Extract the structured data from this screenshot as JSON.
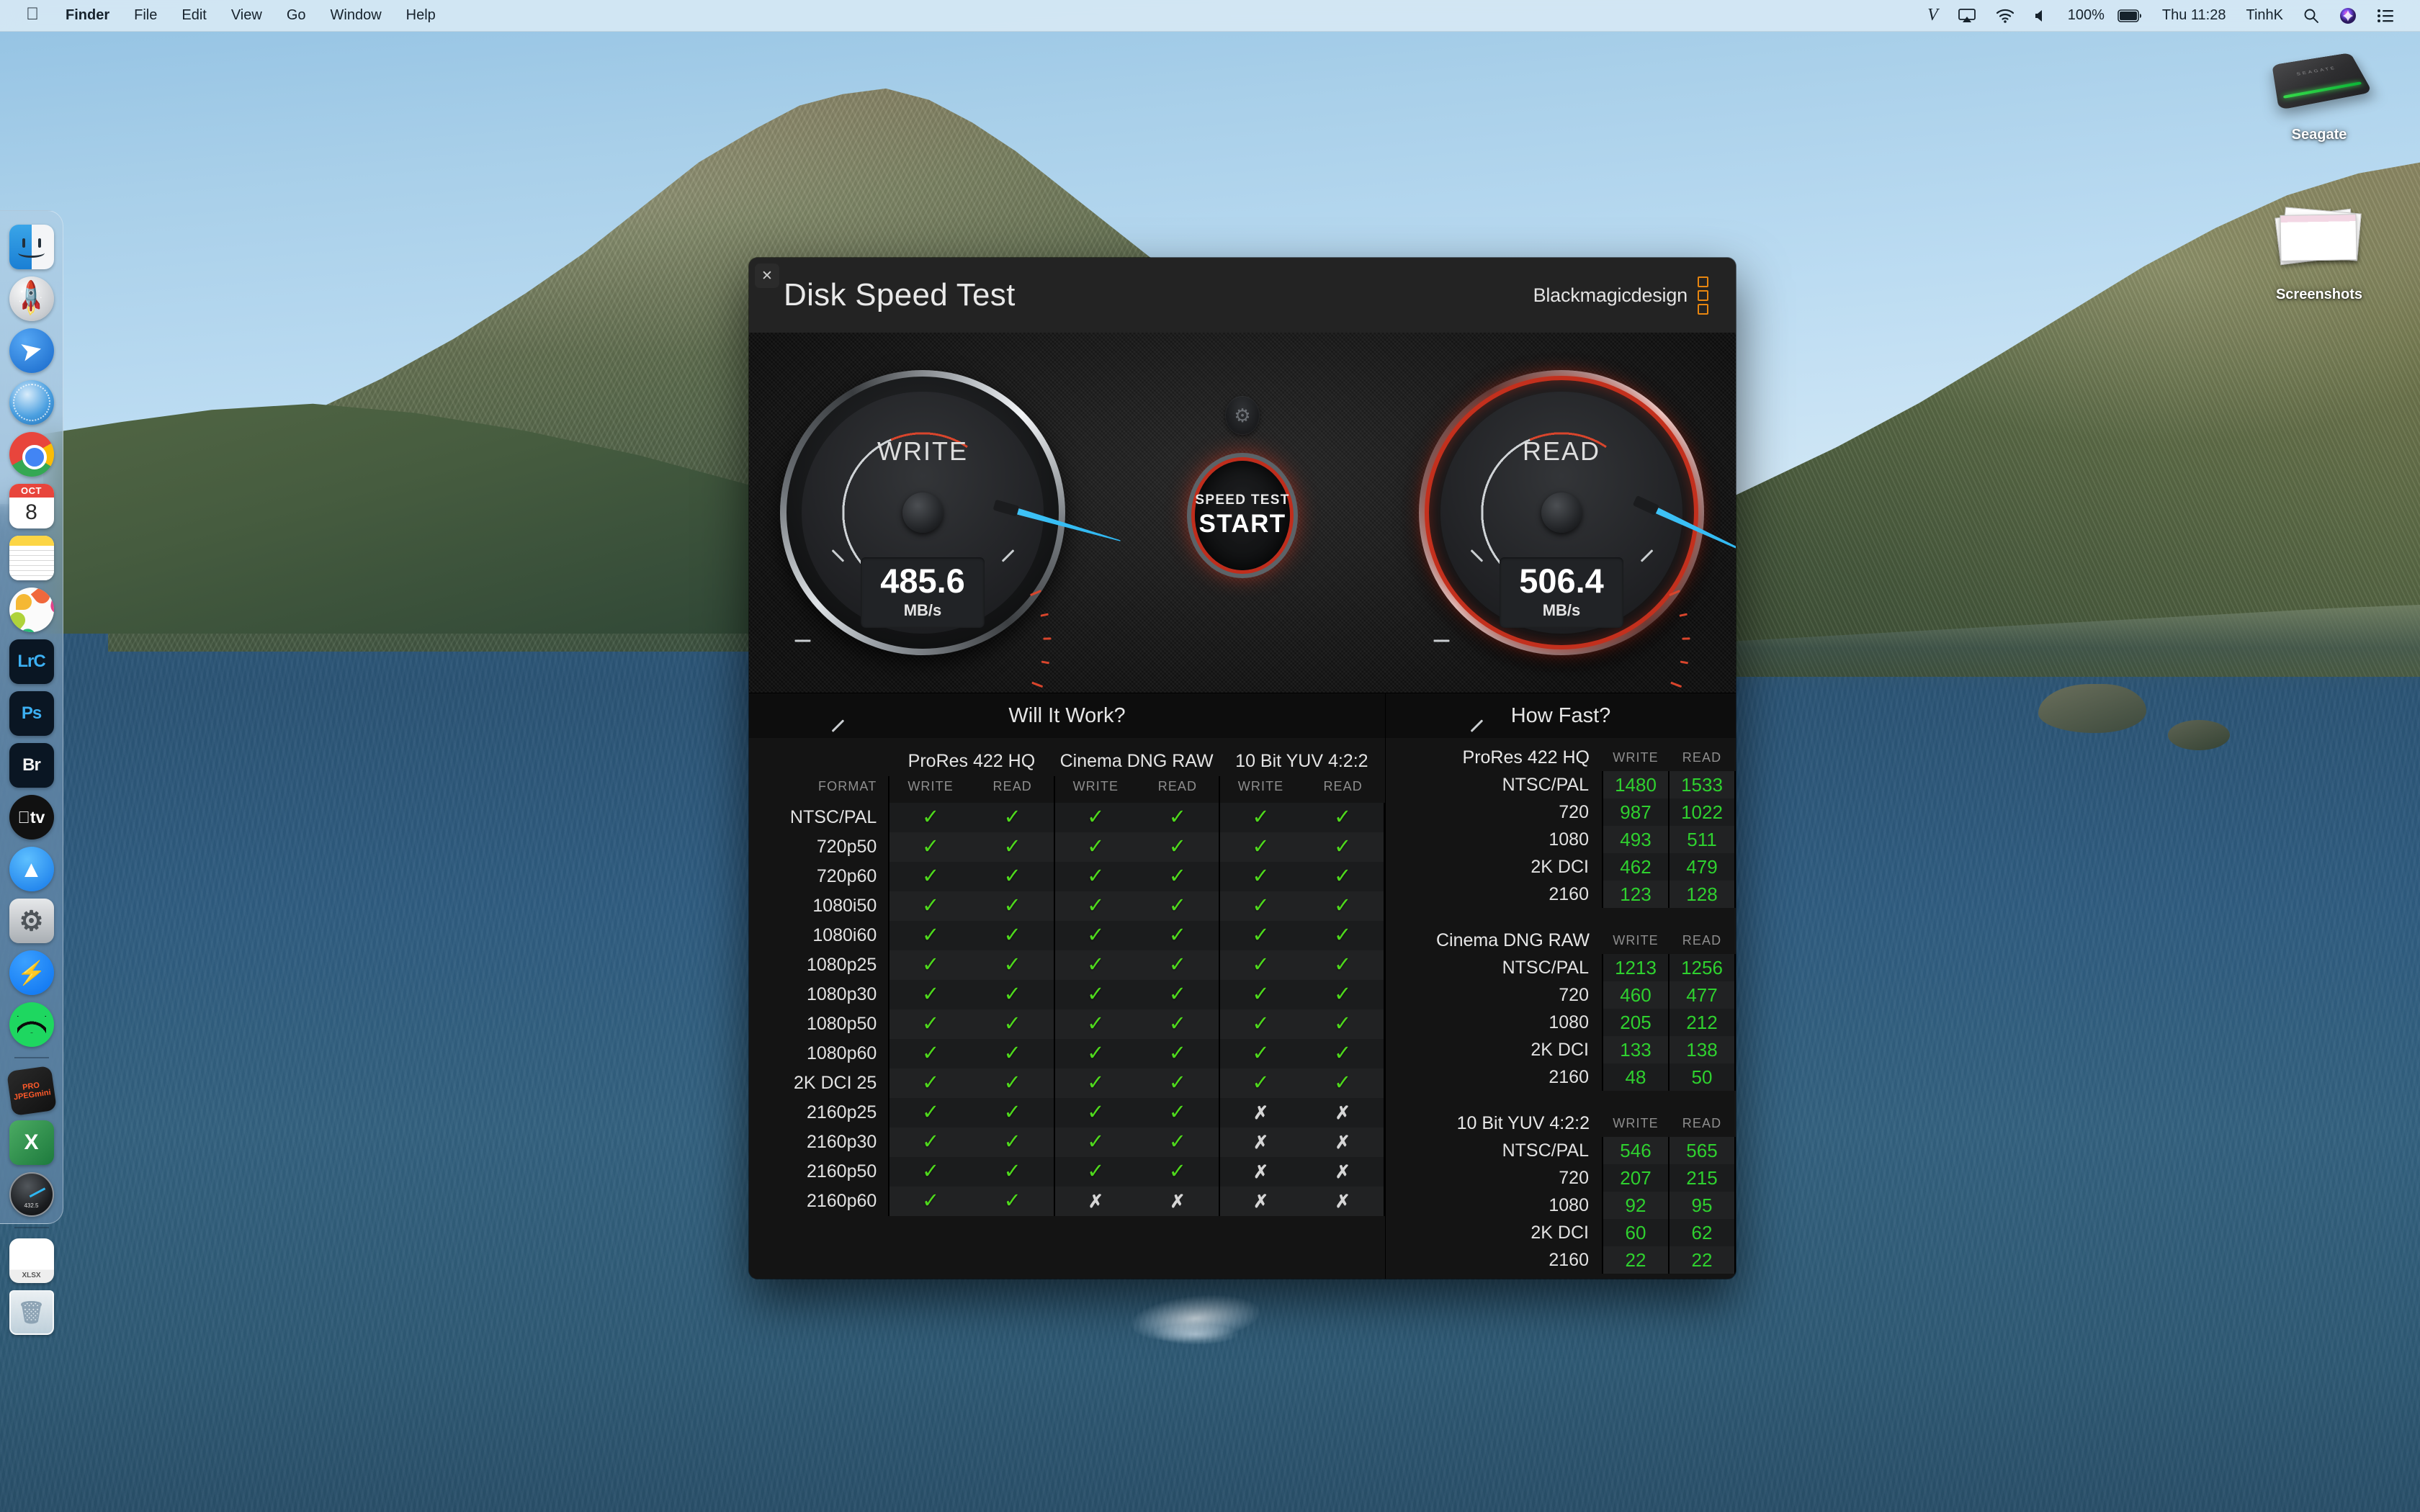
{
  "menubar": {
    "apple_icon": "apple-logo",
    "items": [
      "Finder",
      "File",
      "Edit",
      "View",
      "Go",
      "Window",
      "Help"
    ],
    "status": {
      "vpn": "V",
      "airplay_icon": "airplay-icon",
      "wifi_icon": "wifi-icon",
      "volume_icon": "volume-icon",
      "battery_percent": "100%",
      "battery_icon": "battery-icon",
      "datetime": "Thu 11:28",
      "user": "TinhK",
      "search_icon": "search-icon",
      "siri_icon": "siri-icon",
      "controlcenter_icon": "control-center-icon"
    }
  },
  "dock": {
    "items": [
      {
        "name": "finder",
        "label": "Finder",
        "running": true
      },
      {
        "name": "launchpad",
        "label": "Launchpad",
        "running": false
      },
      {
        "name": "spark",
        "label": "Spark",
        "running": true
      },
      {
        "name": "safari",
        "label": "Safari",
        "running": false
      },
      {
        "name": "chrome",
        "label": "Google Chrome",
        "running": true
      },
      {
        "name": "calendar",
        "label": "Calendar",
        "month": "OCT",
        "day": "8",
        "running": false
      },
      {
        "name": "notes",
        "label": "Notes",
        "running": false
      },
      {
        "name": "photos",
        "label": "Photos",
        "running": false
      },
      {
        "name": "lightroom-classic",
        "label": "LrC",
        "running": false
      },
      {
        "name": "photoshop",
        "label": "Ps",
        "running": false
      },
      {
        "name": "bridge",
        "label": "Br",
        "running": false
      },
      {
        "name": "apple-tv",
        "label": "tv",
        "running": false
      },
      {
        "name": "app-store",
        "label": "App Store",
        "running": true
      },
      {
        "name": "system-preferences",
        "label": "System Preferences",
        "running": false
      },
      {
        "name": "messenger",
        "label": "Messenger",
        "running": true
      },
      {
        "name": "spotify",
        "label": "Spotify",
        "running": false
      },
      {
        "name": "jpegmini-pro",
        "label": "PRO JPEGmini",
        "running": false
      },
      {
        "name": "excel",
        "label": "X",
        "running": true
      },
      {
        "name": "disk-speed-test",
        "label": "Disk Speed Test",
        "value": "432.5",
        "running": true
      },
      {
        "name": "xlsx-file",
        "label": "XLSX",
        "running": false
      },
      {
        "name": "trash",
        "label": "Trash",
        "running": false
      }
    ]
  },
  "desktop_icons": [
    {
      "name": "seagate-drive",
      "label": "Seagate"
    },
    {
      "name": "screenshots-folder",
      "label": "Screenshots"
    }
  ],
  "window": {
    "title": "Disk Speed Test",
    "brand": "Blackmagicdesign",
    "close_label": "✕",
    "brand_color": "#e8860f"
  },
  "gauges": {
    "write": {
      "label": "WRITE",
      "value": "485.6",
      "unit": "MB/s",
      "needle_color": "#2fb6f0"
    },
    "read": {
      "label": "READ",
      "value": "506.4",
      "unit": "MB/s",
      "needle_color": "#2fb6f0"
    },
    "start_button": {
      "line1": "SPEED TEST",
      "line2": "START"
    },
    "settings_icon": "gear-icon"
  },
  "will_it_work": {
    "title": "Will It Work?",
    "format_header": "FORMAT",
    "groups": [
      "ProRes 422 HQ",
      "Cinema DNG RAW",
      "10 Bit YUV 4:2:2"
    ],
    "sub_headers": [
      "WRITE",
      "READ",
      "WRITE",
      "READ",
      "WRITE",
      "READ"
    ],
    "ok_glyph": "✓",
    "fail_glyph": "✗",
    "rows": [
      {
        "format": "NTSC/PAL",
        "cells": [
          true,
          true,
          true,
          true,
          true,
          true
        ]
      },
      {
        "format": "720p50",
        "cells": [
          true,
          true,
          true,
          true,
          true,
          true
        ]
      },
      {
        "format": "720p60",
        "cells": [
          true,
          true,
          true,
          true,
          true,
          true
        ]
      },
      {
        "format": "1080i50",
        "cells": [
          true,
          true,
          true,
          true,
          true,
          true
        ]
      },
      {
        "format": "1080i60",
        "cells": [
          true,
          true,
          true,
          true,
          true,
          true
        ]
      },
      {
        "format": "1080p25",
        "cells": [
          true,
          true,
          true,
          true,
          true,
          true
        ]
      },
      {
        "format": "1080p30",
        "cells": [
          true,
          true,
          true,
          true,
          true,
          true
        ]
      },
      {
        "format": "1080p50",
        "cells": [
          true,
          true,
          true,
          true,
          true,
          true
        ]
      },
      {
        "format": "1080p60",
        "cells": [
          true,
          true,
          true,
          true,
          true,
          true
        ]
      },
      {
        "format": "2K DCI 25",
        "cells": [
          true,
          true,
          true,
          true,
          true,
          true
        ]
      },
      {
        "format": "2160p25",
        "cells": [
          true,
          true,
          true,
          true,
          false,
          false
        ]
      },
      {
        "format": "2160p30",
        "cells": [
          true,
          true,
          true,
          true,
          false,
          false
        ]
      },
      {
        "format": "2160p50",
        "cells": [
          true,
          true,
          true,
          true,
          false,
          false
        ]
      },
      {
        "format": "2160p60",
        "cells": [
          true,
          true,
          false,
          false,
          false,
          false
        ]
      }
    ]
  },
  "how_fast": {
    "title": "How Fast?",
    "col_write": "WRITE",
    "col_read": "READ",
    "groups": [
      {
        "name": "ProRes 422 HQ",
        "rows": [
          {
            "format": "NTSC/PAL",
            "write": "1480",
            "read": "1533"
          },
          {
            "format": "720",
            "write": "987",
            "read": "1022"
          },
          {
            "format": "1080",
            "write": "493",
            "read": "511"
          },
          {
            "format": "2K DCI",
            "write": "462",
            "read": "479"
          },
          {
            "format": "2160",
            "write": "123",
            "read": "128"
          }
        ]
      },
      {
        "name": "Cinema DNG RAW",
        "rows": [
          {
            "format": "NTSC/PAL",
            "write": "1213",
            "read": "1256"
          },
          {
            "format": "720",
            "write": "460",
            "read": "477"
          },
          {
            "format": "1080",
            "write": "205",
            "read": "212"
          },
          {
            "format": "2K DCI",
            "write": "133",
            "read": "138"
          },
          {
            "format": "2160",
            "write": "48",
            "read": "50"
          }
        ]
      },
      {
        "name": "10 Bit YUV 4:2:2",
        "rows": [
          {
            "format": "NTSC/PAL",
            "write": "546",
            "read": "565"
          },
          {
            "format": "720",
            "write": "207",
            "read": "215"
          },
          {
            "format": "1080",
            "write": "92",
            "read": "95"
          },
          {
            "format": "2K DCI",
            "write": "60",
            "read": "62"
          },
          {
            "format": "2160",
            "write": "22",
            "read": "22"
          }
        ]
      }
    ]
  }
}
